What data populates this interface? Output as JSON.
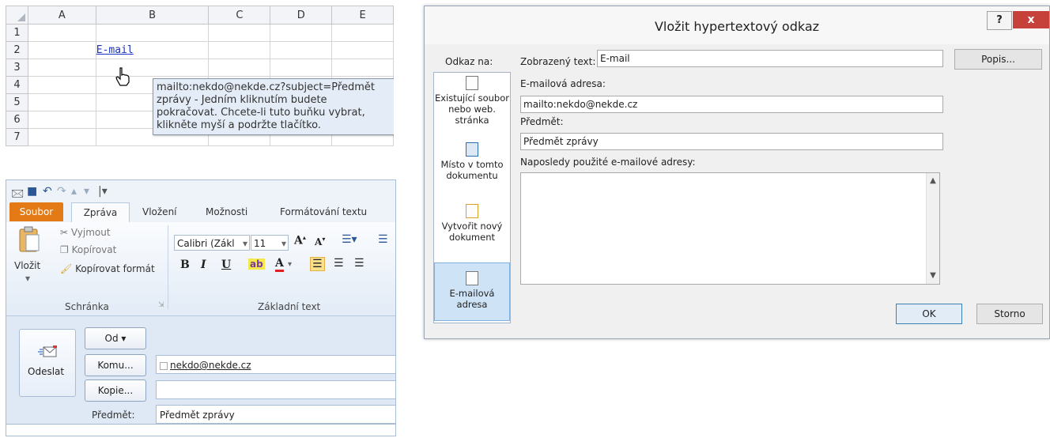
{
  "excel": {
    "columns": [
      "A",
      "B",
      "C",
      "D",
      "E"
    ],
    "rows": [
      "1",
      "2",
      "3",
      "4",
      "5",
      "6",
      "7"
    ],
    "link_text": "E-mail",
    "tooltip": "mailto:nekdo@nekde.cz?subject=Předmět zprávy - Jedním kliknutím budete pokračovat. Chcete-li tuto buňku vybrat, klikněte myší a podržte tlačítko."
  },
  "outlook": {
    "tabs": {
      "file": "Soubor",
      "message": "Zpráva",
      "insert": "Vložení",
      "options": "Možnosti",
      "format_text": "Formátování textu"
    },
    "clipboard": {
      "paste": "Vložit",
      "cut": "Vyjmout",
      "copy": "Kopírovat",
      "format_painter": "Kopírovat formát",
      "group": "Schránka"
    },
    "basic_text": {
      "font": "Calibri (Zákl",
      "size": "11",
      "bold": "B",
      "italic": "I",
      "underline": "U",
      "group": "Základní text"
    },
    "compose": {
      "send": "Odeslat",
      "from": "Od ▾",
      "to": "Komu...",
      "cc": "Kopie...",
      "to_value": "nekdo@nekde.cz",
      "subject_label": "Předmět:",
      "subject_value": "Předmět zprávy"
    }
  },
  "dialog": {
    "title": "Vložit hypertextový odkaz",
    "help": "?",
    "close": "x",
    "link_to_label": "Odkaz na:",
    "display_text_label": "Zobrazený text:",
    "display_text_value": "E-mail",
    "popis": "Popis...",
    "email_label": "E-mailová adresa:",
    "email_value": "mailto:nekdo@nekde.cz",
    "subject_label": "Předmět:",
    "subject_value": "Předmět zprávy",
    "recent_label": "Naposledy použité e-mailové adresy:",
    "link_items": {
      "existing": "Existující soubor nebo web. stránka",
      "place": "Místo v tomto dokumentu",
      "new_doc": "Vytvořit nový dokument",
      "email": "E-mailová adresa"
    },
    "ok": "OK",
    "cancel": "Storno"
  }
}
